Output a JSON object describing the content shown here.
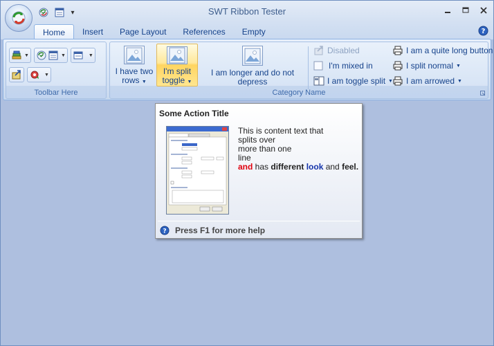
{
  "window": {
    "title": "SWT Ribbon Tester"
  },
  "quick_access": {
    "icons": [
      "refresh-check-icon",
      "list-window-icon"
    ],
    "more_glyph": "≤"
  },
  "tabs": [
    {
      "label": "Home",
      "active": true
    },
    {
      "label": "Insert",
      "active": false
    },
    {
      "label": "Page Layout",
      "active": false
    },
    {
      "label": "References",
      "active": false
    },
    {
      "label": "Empty",
      "active": false
    }
  ],
  "groups": {
    "toolbar": {
      "label": "Toolbar Here"
    },
    "category": {
      "label": "Category Name",
      "big_buttons": [
        {
          "line1": "I have two",
          "line2": "rows"
        },
        {
          "line1": "I'm split",
          "line2": "toggle"
        },
        {
          "line1": "I am longer and do not depress",
          "line2": ""
        }
      ],
      "small_buttons_col1": [
        {
          "label": "Disabled"
        },
        {
          "label": "I'm mixed in"
        },
        {
          "label": "I am toggle split"
        }
      ],
      "small_buttons_col2": [
        {
          "label": "I am a quite long button"
        },
        {
          "label": "I split normal"
        },
        {
          "label": "I am arrowed"
        }
      ]
    }
  },
  "tooltip": {
    "title": "Some Action Title",
    "lines": [
      "This is content text that",
      "splits over",
      "more than one",
      "line"
    ],
    "rich": {
      "w1": "and",
      "w2": " has ",
      "w3": "different",
      "w4": " ",
      "w5": "look",
      "w6": " and ",
      "w7": "feel."
    },
    "help": "Press F1 for more help"
  },
  "colors": {
    "background": "#aebfdf",
    "accent_text": "#15428b",
    "highlight": "#ffd560",
    "red_word": "#e0000f",
    "blue_word": "#1433aa"
  }
}
